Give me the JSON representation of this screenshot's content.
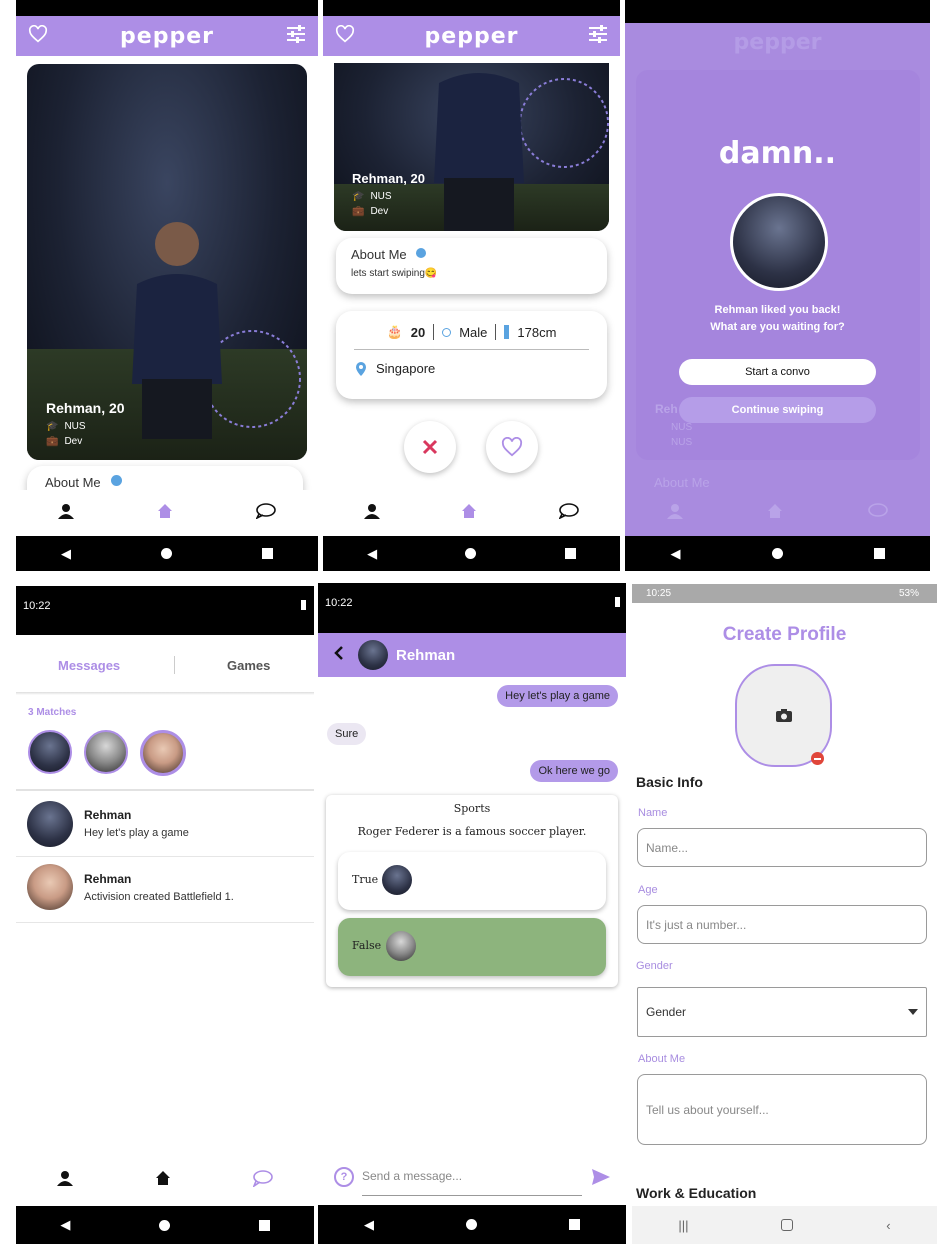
{
  "brand": "pepper",
  "profile": {
    "name_age": "Rehman, 20",
    "school": "NUS",
    "work": "Dev",
    "about_title": "About Me",
    "about_text": "lets start swiping😋",
    "age": "20",
    "gender": "Male",
    "height": "178cm",
    "location": "Singapore"
  },
  "match_overlay": {
    "title": "damn..",
    "line1": "Rehman liked you back!",
    "line2": "What are you waiting for?",
    "start_button": "Start a convo",
    "continue_button": "Continue swiping",
    "bg_name": "Reh",
    "bg_school": "NUS",
    "bg_work": "NUS",
    "bg_about": "About Me"
  },
  "messages_screen": {
    "time": "10:22",
    "tabs": [
      "Messages",
      "Games"
    ],
    "matches_label": "3 Matches",
    "conversations": [
      {
        "name": "Rehman",
        "preview": "Hey let's play a game"
      },
      {
        "name": "Rehman",
        "preview": "Activision created Battlefield 1."
      }
    ]
  },
  "chat_screen": {
    "time": "10:22",
    "contact": "Rehman",
    "messages": [
      {
        "from": "me",
        "text": "Hey let's play a game"
      },
      {
        "from": "them",
        "text": "Sure"
      },
      {
        "from": "me",
        "text": "Ok here we go"
      }
    ],
    "game": {
      "category": "Sports",
      "question": "Roger Federer is a famous soccer player.",
      "option_true": "True",
      "option_false": "False"
    },
    "input_placeholder": "Send a message..."
  },
  "create_profile": {
    "status_time": "10:25",
    "battery": "53%",
    "title": "Create Profile",
    "basic_info": "Basic Info",
    "name_label": "Name",
    "name_placeholder": "Name...",
    "age_label": "Age",
    "age_placeholder": "It's just a number...",
    "gender_label": "Gender",
    "gender_value": "Gender",
    "about_label": "About Me",
    "about_placeholder": "Tell us about yourself...",
    "work_edu": "Work & Education"
  },
  "colors": {
    "accent": "#ad8ee6",
    "accent_text": "#a88de0",
    "false_option": "#8db47d",
    "reject": "#d9385e"
  }
}
